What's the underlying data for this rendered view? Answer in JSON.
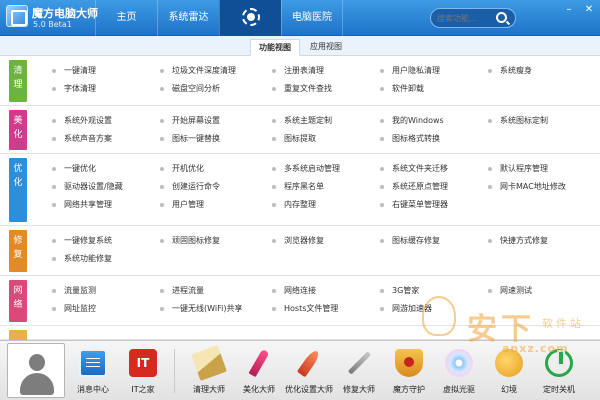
{
  "titlebar": {
    "app_name": "魔方电脑大师",
    "version": "5.0 Beta1",
    "nav": [
      {
        "label": "主页"
      },
      {
        "label": "系统雷达"
      },
      {
        "label": "",
        "icon": "sun-icon",
        "active": true
      },
      {
        "label": "电脑医院"
      }
    ],
    "search_placeholder": "搜索功能...",
    "window_controls": [
      "minimize-icon",
      "close-icon"
    ]
  },
  "views": {
    "function_view": "功能视图",
    "app_view": "应用视图"
  },
  "categories": [
    {
      "label": "清理",
      "color": "#6db33f",
      "items": [
        "一键清理",
        "垃圾文件深度清理",
        "注册表清理",
        "用户隐私清理",
        "系统瘦身",
        "字体清理",
        "磁盘空间分析",
        "重复文件查找",
        "软件卸载"
      ]
    },
    {
      "label": "美化",
      "color": "#cf3c8c",
      "items": [
        "系统外观设置",
        "开始屏幕设置",
        "系统主题定制",
        "我的Windows",
        "系统图标定制",
        "系统声音方案",
        "图标一键替换",
        "图标提取",
        "图标格式转换"
      ]
    },
    {
      "label": "优化",
      "color": "#2e8fd8",
      "items": [
        "一键优化",
        "开机优化",
        "多系统启动管理",
        "系统文件夹迁移",
        "默认程序管理",
        "驱动器设置/隐藏",
        "创建运行命令",
        "程序黑名单",
        "系统还原点管理",
        "网卡MAC地址修改",
        "网络共享管理",
        "用户管理",
        "内存整理",
        "右键菜单管理器"
      ]
    },
    {
      "label": "修复",
      "color": "#e08a2a",
      "items": [
        "一键修复系统",
        "顽固图标修复",
        "浏览器修复",
        "图标缓存修复",
        "快捷方式修复",
        "系统功能修复"
      ]
    },
    {
      "label": "网络",
      "color": "#d94a7a",
      "items": [
        "流量监测",
        "进程流量",
        "网络连接",
        "3G管家",
        "网速测试",
        "网址监控",
        "一键无线(WiFi)共享",
        "Hosts文件管理",
        "网游加速器"
      ]
    }
  ],
  "dock": {
    "avatar": "user-avatar",
    "items": [
      {
        "label": "消息中心",
        "icon": "message-center-icon"
      },
      {
        "label": "IT之家",
        "icon": "ithome-icon",
        "icon_text": "IT"
      },
      {
        "label": "清理大师",
        "icon": "broom-icon"
      },
      {
        "label": "美化大师",
        "icon": "paintbrush-icon"
      },
      {
        "label": "优化设置大师",
        "icon": "rocket-icon"
      },
      {
        "label": "修复大师",
        "icon": "wrench-icon"
      },
      {
        "label": "魔方守护",
        "icon": "shield-icon"
      },
      {
        "label": "虚拟光驱",
        "icon": "disc-icon"
      },
      {
        "label": "幻境",
        "icon": "magic-orb-icon"
      },
      {
        "label": "定时关机",
        "icon": "power-icon"
      }
    ]
  },
  "watermark": {
    "big": "安下",
    "small": "软件站",
    "site": "anxz.com"
  }
}
